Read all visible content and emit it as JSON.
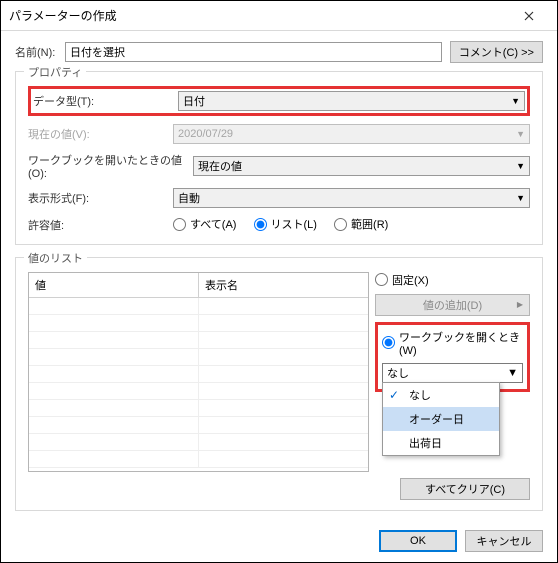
{
  "window": {
    "title": "パラメーターの作成"
  },
  "name": {
    "label": "名前(N):",
    "value": "日付を選択"
  },
  "comment_btn": "コメント(C) >>",
  "properties": {
    "legend": "プロパティ",
    "datatype": {
      "label": "データ型(T):",
      "value": "日付"
    },
    "current": {
      "label": "現在の値(V):",
      "value": "2020/07/29"
    },
    "onopen": {
      "label": "ワークブックを開いたときの値(O):",
      "value": "現在の値"
    },
    "format": {
      "label": "表示形式(F):",
      "value": "自動"
    },
    "allow": {
      "label": "許容値:",
      "all": "すべて(A)",
      "list": "リスト(L)",
      "range": "範囲(R)"
    }
  },
  "valuelist": {
    "legend": "値のリスト",
    "col_value": "値",
    "col_display": "表示名",
    "fixed": "固定(X)",
    "addvalue": "値の追加(D)",
    "onopen": "ワークブックを開くとき(W)",
    "dd_value": "なし",
    "dd_items": {
      "none": "なし",
      "order": "オーダー日",
      "ship": "出荷日"
    },
    "clear": "すべてクリア(C)"
  },
  "footer": {
    "ok": "OK",
    "cancel": "キャンセル"
  }
}
